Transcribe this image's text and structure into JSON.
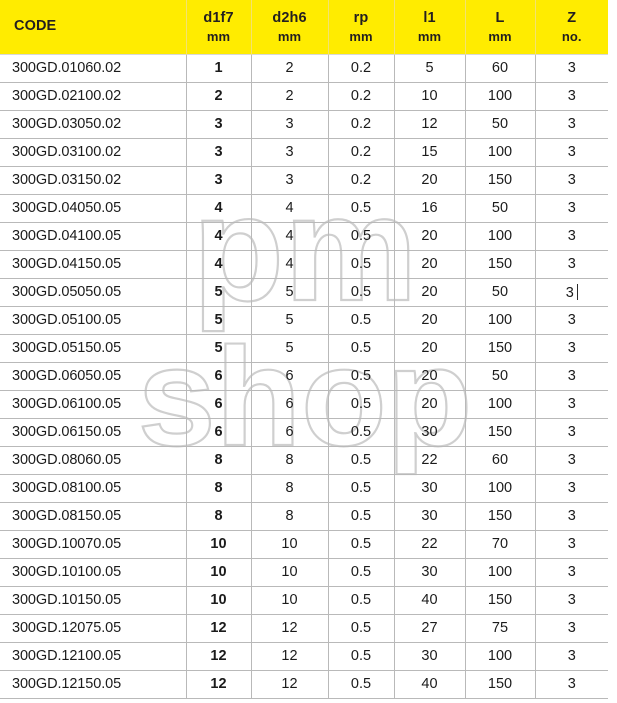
{
  "watermark": {
    "line1": "pm",
    "line2": "shop",
    "color": "#cfcfcf"
  },
  "table": {
    "header_bg": "#FFEC00",
    "header_text_color": "#231f20",
    "grid_color": "#b9b9b9",
    "columns": [
      {
        "symbol": "CODE",
        "unit": ""
      },
      {
        "symbol": "d1f7",
        "unit": "mm"
      },
      {
        "symbol": "d2h6",
        "unit": "mm"
      },
      {
        "symbol": "rp",
        "unit": "mm"
      },
      {
        "symbol": "l1",
        "unit": "mm"
      },
      {
        "symbol": "L",
        "unit": "mm"
      },
      {
        "symbol": "Z",
        "unit": "no."
      }
    ],
    "rows": [
      {
        "code": "300GD.01060.02",
        "d1": "1",
        "d2": "2",
        "rp": "0.2",
        "l1": "5",
        "L": "60",
        "z": "3"
      },
      {
        "code": "300GD.02100.02",
        "d1": "2",
        "d2": "2",
        "rp": "0.2",
        "l1": "10",
        "L": "100",
        "z": "3"
      },
      {
        "code": "300GD.03050.02",
        "d1": "3",
        "d2": "3",
        "rp": "0.2",
        "l1": "12",
        "L": "50",
        "z": "3"
      },
      {
        "code": "300GD.03100.02",
        "d1": "3",
        "d2": "3",
        "rp": "0.2",
        "l1": "15",
        "L": "100",
        "z": "3"
      },
      {
        "code": "300GD.03150.02",
        "d1": "3",
        "d2": "3",
        "rp": "0.2",
        "l1": "20",
        "L": "150",
        "z": "3"
      },
      {
        "code": "300GD.04050.05",
        "d1": "4",
        "d2": "4",
        "rp": "0.5",
        "l1": "16",
        "L": "50",
        "z": "3"
      },
      {
        "code": "300GD.04100.05",
        "d1": "4",
        "d2": "4",
        "rp": "0.5",
        "l1": "20",
        "L": "100",
        "z": "3"
      },
      {
        "code": "300GD.04150.05",
        "d1": "4",
        "d2": "4",
        "rp": "0.5",
        "l1": "20",
        "L": "150",
        "z": "3"
      },
      {
        "code": "300GD.05050.05",
        "d1": "5",
        "d2": "5",
        "rp": "0.5",
        "l1": "20",
        "L": "50",
        "z": "3",
        "caret": true
      },
      {
        "code": "300GD.05100.05",
        "d1": "5",
        "d2": "5",
        "rp": "0.5",
        "l1": "20",
        "L": "100",
        "z": "3"
      },
      {
        "code": "300GD.05150.05",
        "d1": "5",
        "d2": "5",
        "rp": "0.5",
        "l1": "20",
        "L": "150",
        "z": "3"
      },
      {
        "code": "300GD.06050.05",
        "d1": "6",
        "d2": "6",
        "rp": "0.5",
        "l1": "20",
        "L": "50",
        "z": "3"
      },
      {
        "code": "300GD.06100.05",
        "d1": "6",
        "d2": "6",
        "rp": "0.5",
        "l1": "20",
        "L": "100",
        "z": "3"
      },
      {
        "code": "300GD.06150.05",
        "d1": "6",
        "d2": "6",
        "rp": "0.5",
        "l1": "30",
        "L": "150",
        "z": "3"
      },
      {
        "code": "300GD.08060.05",
        "d1": "8",
        "d2": "8",
        "rp": "0.5",
        "l1": "22",
        "L": "60",
        "z": "3"
      },
      {
        "code": "300GD.08100.05",
        "d1": "8",
        "d2": "8",
        "rp": "0.5",
        "l1": "30",
        "L": "100",
        "z": "3"
      },
      {
        "code": "300GD.08150.05",
        "d1": "8",
        "d2": "8",
        "rp": "0.5",
        "l1": "30",
        "L": "150",
        "z": "3"
      },
      {
        "code": "300GD.10070.05",
        "d1": "10",
        "d2": "10",
        "rp": "0.5",
        "l1": "22",
        "L": "70",
        "z": "3"
      },
      {
        "code": "300GD.10100.05",
        "d1": "10",
        "d2": "10",
        "rp": "0.5",
        "l1": "30",
        "L": "100",
        "z": "3"
      },
      {
        "code": "300GD.10150.05",
        "d1": "10",
        "d2": "10",
        "rp": "0.5",
        "l1": "40",
        "L": "150",
        "z": "3"
      },
      {
        "code": "300GD.12075.05",
        "d1": "12",
        "d2": "12",
        "rp": "0.5",
        "l1": "27",
        "L": "75",
        "z": "3"
      },
      {
        "code": "300GD.12100.05",
        "d1": "12",
        "d2": "12",
        "rp": "0.5",
        "l1": "30",
        "L": "100",
        "z": "3"
      },
      {
        "code": "300GD.12150.05",
        "d1": "12",
        "d2": "12",
        "rp": "0.5",
        "l1": "40",
        "L": "150",
        "z": "3"
      }
    ]
  }
}
